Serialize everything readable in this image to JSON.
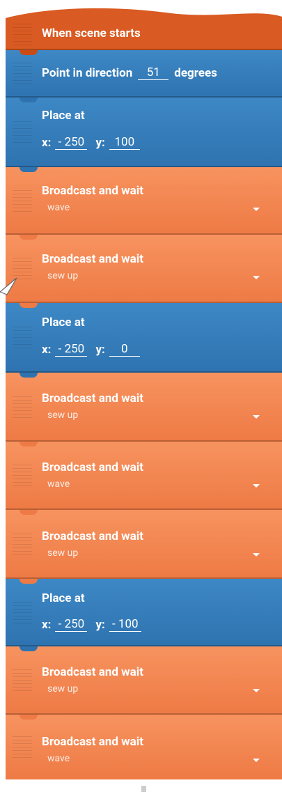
{
  "colors": {
    "hat": "#d95a22",
    "motion": "#2e73b0",
    "events": "#ee7a45"
  },
  "hat": {
    "label": "When scene starts"
  },
  "point": {
    "label": "Point in direction",
    "value": "51",
    "unit": "degrees"
  },
  "place1": {
    "label": "Place at",
    "x_label": "x:",
    "x": "- 250",
    "y_label": "y:",
    "y": "100"
  },
  "bw1": {
    "label": "Broadcast and wait",
    "message": "wave"
  },
  "bw2": {
    "label": "Broadcast and wait",
    "message": "sew up"
  },
  "place2": {
    "label": "Place at",
    "x_label": "x:",
    "x": "- 250",
    "y_label": "y:",
    "y": "0"
  },
  "bw3": {
    "label": "Broadcast and wait",
    "message": "sew up"
  },
  "bw4": {
    "label": "Broadcast and wait",
    "message": "wave"
  },
  "bw5": {
    "label": "Broadcast and wait",
    "message": "sew up"
  },
  "place3": {
    "label": "Place at",
    "x_label": "x:",
    "x": "- 250",
    "y_label": "y:",
    "y": "- 100"
  },
  "bw6": {
    "label": "Broadcast and wait",
    "message": "sew up"
  },
  "bw7": {
    "label": "Broadcast and wait",
    "message": "wave"
  }
}
